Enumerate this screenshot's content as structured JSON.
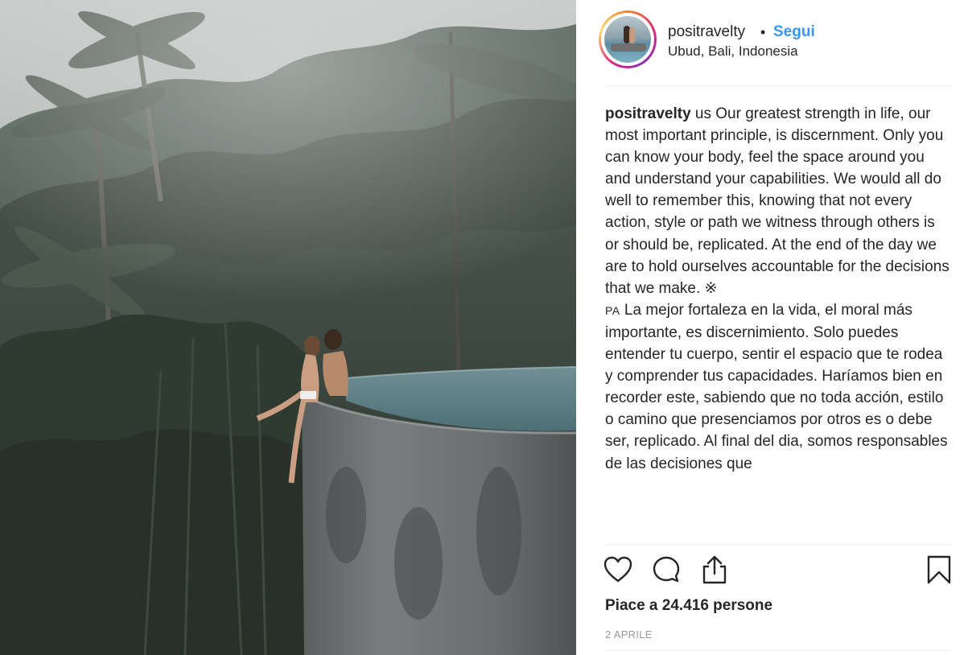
{
  "post": {
    "username": "positravelty",
    "separator": "•",
    "follow_label": "Segui",
    "location": "Ubud, Bali, Indonesia"
  },
  "caption": {
    "username": "positravelty",
    "english_text": " us Our greatest strength in life, our most important principle, is discernment. Only you can know your body, feel the space around you and understand your capabilities. We would all do well to remember this, knowing that not every action, style or path we witness through others is or should be, replicated. At the end of the day we are to hold ourselves accountable for the decisions that we make. ※",
    "spanish_prefix": "PA",
    "spanish_text": " La mejor fortaleza en la vida, el moral más importante, es discernimiento. Solo puedes entender tu cuerpo, sentir el espacio que te rodea y comprender tus capacidades. Haríamos bien en recorder este, sabiendo que no toda acción, estilo o camino que presenciamos por otros es o debe ser, replicado. Al final del dia, somos responsables de las decisiones que"
  },
  "actions": {
    "like_icon": "heart-icon",
    "comment_icon": "comment-icon",
    "share_icon": "share-icon",
    "save_icon": "bookmark-icon"
  },
  "likes_text": "Piace a 24.416 persone",
  "date_text": "2 APRILE",
  "colors": {
    "link_blue": "#3897f0",
    "text": "#262626",
    "muted": "#999999",
    "divider": "#efefef"
  }
}
